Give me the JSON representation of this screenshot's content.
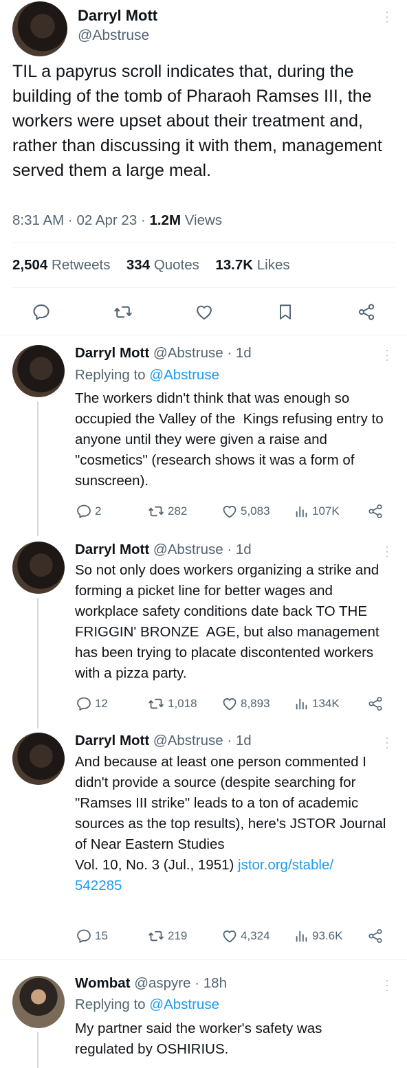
{
  "main_tweet": {
    "author_name": "Darryl Mott",
    "author_handle": "@Abstruse",
    "text": "TIL a papyrus scroll indicates that, during the building of the tomb of Pharaoh Ramses III, the workers were upset about their treatment and,  rather than discussing it with them, management served them a large meal.",
    "time": "8:31 AM",
    "date": "02 Apr 23",
    "views_count": "1.2M",
    "views_label": "Views",
    "retweets_count": "2,504",
    "retweets_label": "Retweets",
    "quotes_count": "334",
    "quotes_label": "Quotes",
    "likes_count": "13.7K",
    "likes_label": "Likes"
  },
  "replies": [
    {
      "author_name": "Darryl Mott",
      "author_handle": "@Abstruse",
      "age": "1d",
      "replying_prefix": "Replying to",
      "replying_to": "@Abstruse",
      "text": "The workers didn't think that was enough so occupied the Valley of the  Kings refusing entry to anyone until they were given a raise and  \"cosmetics\" (research shows it was a form of sunscreen).",
      "replies": "2",
      "retweets": "282",
      "likes": "5,083",
      "views": "107K"
    },
    {
      "author_name": "Darryl Mott",
      "author_handle": "@Abstruse",
      "age": "1d",
      "text": "So not only does workers organizing a strike and forming a picket line for better wages and workplace safety conditions date back TO THE FRIGGIN' BRONZE  AGE, but also management has been trying to placate discontented workers with a pizza party.",
      "replies": "12",
      "retweets": "1,018",
      "likes": "8,893",
      "views": "134K"
    },
    {
      "author_name": "Darryl Mott",
      "author_handle": "@Abstruse",
      "age": "1d",
      "text": "And because at least one person commented I didn't provide a source (despite searching for \"Ramses III strike\" leads to a ton of academic sources as the top results), here's JSTOR Journal of Near Eastern Studies\nVol. 10, No. 3 (Jul., 1951) ",
      "link": "jstor.org/stable/\n542285",
      "replies": "15",
      "retweets": "219",
      "likes": "4,324",
      "views": "93.6K"
    },
    {
      "author_name": "Wombat",
      "author_handle": "@aspyre",
      "age": "18h",
      "replying_prefix": "Replying to",
      "replying_to": "@Abstruse",
      "text": "My partner said the worker's safety was regulated by OSHIRIUS."
    }
  ],
  "separator": "·",
  "colors": {
    "text": "#0f1419",
    "muted": "#536471",
    "link": "#1d9bf0",
    "divider": "#eff3f4"
  },
  "icons": [
    "more-icon",
    "reply-icon",
    "retweet-icon",
    "like-icon",
    "bookmark-icon",
    "share-icon",
    "views-icon"
  ]
}
